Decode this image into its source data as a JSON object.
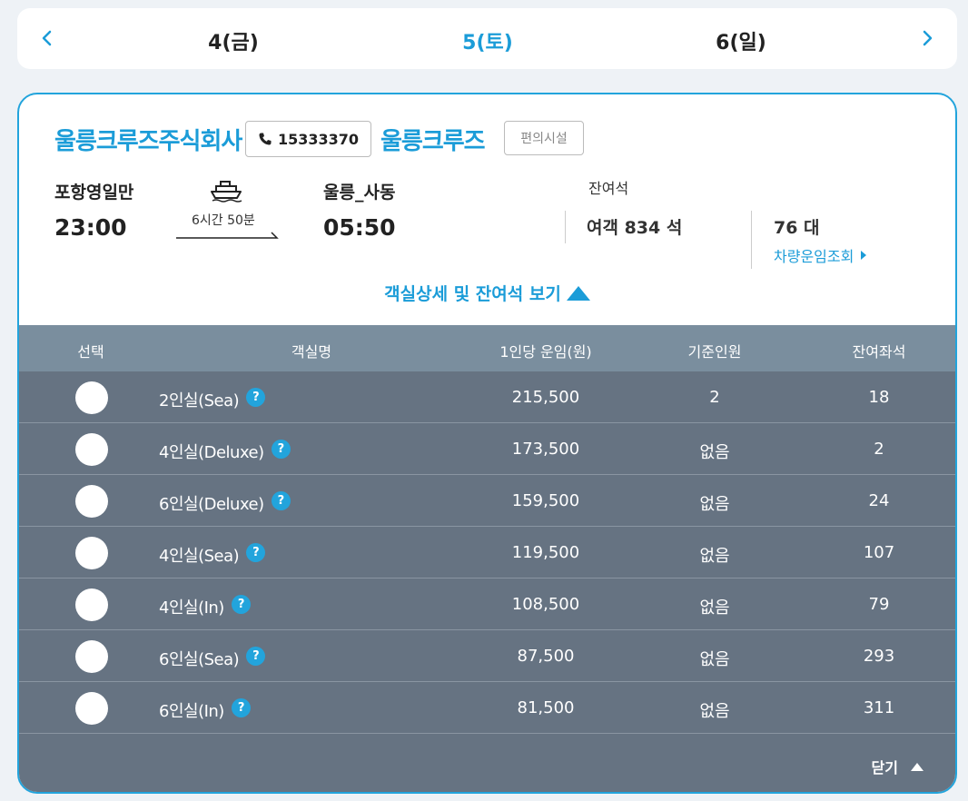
{
  "date_nav": {
    "prev_icon": "chevron-left-icon",
    "next_icon": "chevron-right-icon",
    "dates": [
      "4(금)",
      "5(토)",
      "6(일)"
    ],
    "active_index": 1
  },
  "ferry": {
    "company": "울릉크루즈주식회사",
    "phone": "15333370",
    "brand": "울릉크루즈",
    "facility_button": "편의시설",
    "departure": {
      "port": "포항영일만",
      "time": "23:00"
    },
    "duration": "6시간 50분",
    "arrival": {
      "port": "울릉_사동",
      "time": "05:50"
    },
    "remaining_title": "잔여석",
    "passenger_seats": "여객 834 석",
    "vehicle_count": "76 대",
    "vehicle_fare_link": "차량운임조회"
  },
  "detail_toggle": "객실상세 및 잔여석 보기",
  "table": {
    "headers": [
      "선택",
      "객실명",
      "1인당 운임(원)",
      "기준인원",
      "잔여좌석"
    ],
    "rows": [
      {
        "room": "2인실(Sea)",
        "fare": "215,500",
        "base": "2",
        "remain": "18"
      },
      {
        "room": "4인실(Deluxe)",
        "fare": "173,500",
        "base": "없음",
        "remain": "2"
      },
      {
        "room": "6인실(Deluxe)",
        "fare": "159,500",
        "base": "없음",
        "remain": "24"
      },
      {
        "room": "4인실(Sea)",
        "fare": "119,500",
        "base": "없음",
        "remain": "107"
      },
      {
        "room": "4인실(In)",
        "fare": "108,500",
        "base": "없음",
        "remain": "79"
      },
      {
        "room": "6인실(Sea)",
        "fare": "87,500",
        "base": "없음",
        "remain": "293"
      },
      {
        "room": "6인실(In)",
        "fare": "81,500",
        "base": "없음",
        "remain": "311"
      }
    ],
    "help_glyph": "?"
  },
  "close_label": "닫기",
  "colors": {
    "accent": "#1b9cd8",
    "table_bg": "#667382",
    "table_header": "#7a8e9e"
  }
}
